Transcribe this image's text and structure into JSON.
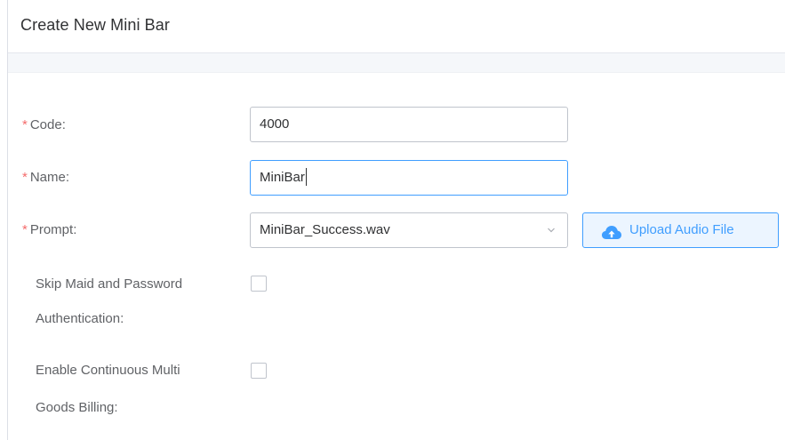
{
  "header": {
    "title": "Create New Mini Bar"
  },
  "form": {
    "code": {
      "required_mark": "*",
      "label": "Code:",
      "value": "4000"
    },
    "name": {
      "required_mark": "*",
      "label": "Name:",
      "value": "MiniBar"
    },
    "prompt": {
      "required_mark": "*",
      "label": "Prompt:",
      "selected": "MiniBar_Success.wav",
      "upload_label": "Upload Audio File"
    },
    "skip_maid": {
      "label_line1": "Skip Maid and Password",
      "label_line2": "Authentication:",
      "checked": false
    },
    "continuous_billing": {
      "label_line1": "Enable Continuous Multi",
      "label_line2": "Goods Billing:",
      "checked": false
    }
  },
  "icons": {
    "upload": "cloud-upload-icon",
    "select_arrow": "chevron-down-icon"
  },
  "colors": {
    "primary": "#409eff",
    "required": "#f56c6c",
    "border": "#c0c4cc",
    "band": "#f5f7fa"
  }
}
